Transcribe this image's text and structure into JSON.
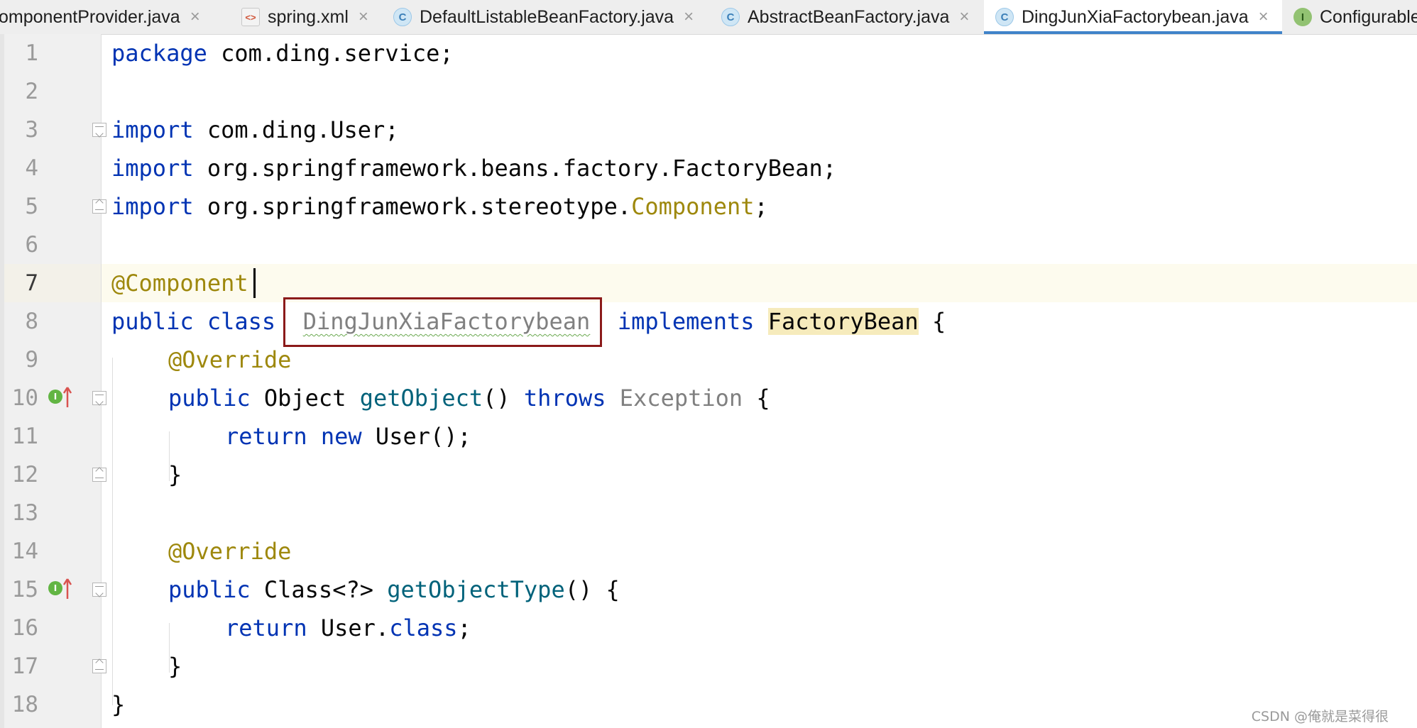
{
  "tabs": [
    {
      "label": "omponentProvider.java",
      "icon": "none"
    },
    {
      "label": "spring.xml",
      "icon": "xml-file-icon"
    },
    {
      "label": "DefaultListableBeanFactory.java",
      "icon": "class-icon"
    },
    {
      "label": "AbstractBeanFactory.java",
      "icon": "class-icon"
    },
    {
      "label": "DingJunXiaFactorybean.java",
      "icon": "class-icon",
      "active": true
    },
    {
      "label": "Configurable",
      "icon": "interface-icon"
    }
  ],
  "tab_close_glyph": "×",
  "icon_letters": {
    "class": "C",
    "interface": "I"
  },
  "line_numbers": [
    "1",
    "2",
    "3",
    "4",
    "5",
    "6",
    "7",
    "8",
    "9",
    "10",
    "11",
    "12",
    "13",
    "14",
    "15",
    "16",
    "17",
    "18"
  ],
  "code": {
    "l1": {
      "kw": "package",
      "rest": " com.ding.service;"
    },
    "l3": {
      "kw": "import",
      "rest": " com.ding.User;"
    },
    "l4": {
      "kw": "import",
      "rest": " org.springframework.beans.factory.FactoryBean;"
    },
    "l5": {
      "kw": "import",
      "rest": " org.springframework.stereotype.",
      "ann": "Component",
      "end": ";"
    },
    "l7": {
      "ann": "@Component"
    },
    "l8": {
      "kw1": "public",
      "kw2": "class",
      "name": "DingJunXiaFactorybean",
      "kw3": "implements",
      "type": "FactoryBean",
      "end": " {"
    },
    "l9": {
      "ann": "@Override"
    },
    "l10": {
      "kw": "public",
      "type": " Object ",
      "fn": "getObject",
      "mid": "() ",
      "kw2": "throws",
      "gray": " Exception",
      "end": " {"
    },
    "l11": {
      "kw1": "return",
      "kw2": " new",
      "rest": " User();"
    },
    "l12": {
      "text": "}"
    },
    "l14": {
      "ann": "@Override"
    },
    "l15": {
      "kw": "public",
      "type": " Class<?> ",
      "fn": "getObjectType",
      "end": "() {"
    },
    "l16": {
      "kw": "return",
      "mid": " User.",
      "kw2": "class",
      "end": ";"
    },
    "l17": {
      "text": "}"
    },
    "l18": {
      "text": "}"
    }
  },
  "watermark": "CSDN @俺就是菜得很"
}
